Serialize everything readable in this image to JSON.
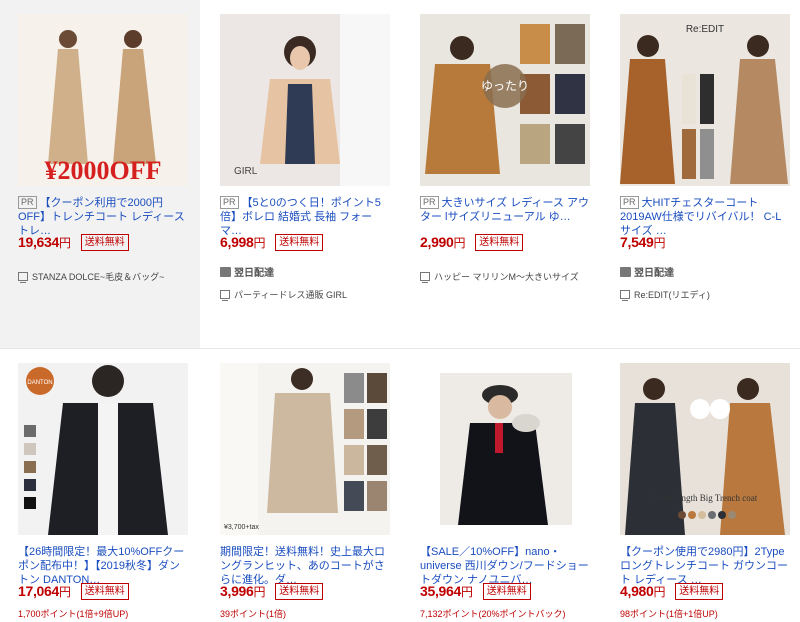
{
  "pr_label": "PR",
  "ship_label": "送料無料",
  "nextday_label": "翌日配達",
  "cards": [
    {
      "title": "【クーポン利用で2000円OFF】トレンチコート レディース トレ…",
      "price_num": "19,634",
      "yen": "円",
      "shop": "STANZA DOLCE~毛皮＆バッグ~",
      "overlay_text": "¥2000OFF"
    },
    {
      "title": "【5と0のつく日！ポイント5倍】ボレロ 結婚式 長袖 フォーマ…",
      "price_num": "6,998",
      "yen": "円",
      "shop": "パーティードレス通販 GIRL",
      "overlay_text": "GIRL"
    },
    {
      "title": "大きいサイズ レディース アウター lサイズリニューアル ゆ…",
      "price_num": "2,990",
      "yen": "円",
      "shop": "ハッピー マリリンM〜大きいサイズ",
      "overlay_text": "ゆったり"
    },
    {
      "title": "大HITチェスターコート2019AW仕様でリバイバル！ C-Lサイズ …",
      "price_num": "7,549",
      "yen": "円",
      "shop": "Re:EDIT(リエディ)",
      "overlay_text": "Re:EDIT"
    },
    {
      "title": "【26時間限定！最大10%OFFクーポン配布中！】【2019秋冬】ダントン DANTON…",
      "price_num": "17,064",
      "yen": "円",
      "points": "1,700ポイント(1倍+9倍UP)",
      "overlay_text": "DANTON"
    },
    {
      "title": "期間限定！送料無料！史上最大ロングランヒット、あのコートがさらに進化。ダ…",
      "price_num": "3,996",
      "yen": "円",
      "points": "39ポイント(1倍)",
      "overlay_text": "¥3,700+tax"
    },
    {
      "title": "【SALE／10%OFF】nano・universe 西川ダウン/フードショートダウン ナノユニバ…",
      "price_num": "35,964",
      "yen": "円",
      "points": "7,132ポイント(20%ポイントバック)",
      "overlay_text": ""
    },
    {
      "title": "【クーポン使用で2980円】2Type ロングトレンチコート ガウンコート レディース …",
      "price_num": "4,980",
      "yen": "円",
      "points": "98ポイント(1倍+1倍UP)",
      "overlay_text": "2type length Big Trench coat"
    }
  ]
}
